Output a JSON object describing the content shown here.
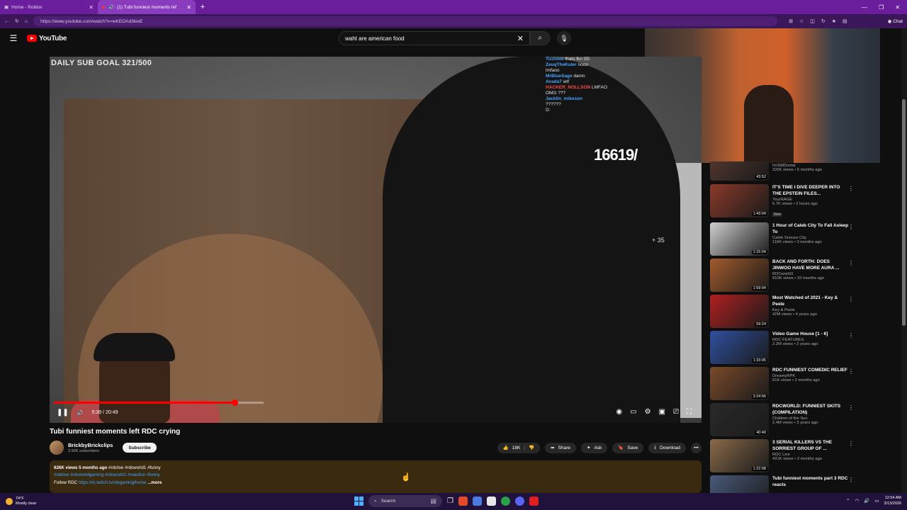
{
  "browser": {
    "tabs": [
      {
        "label": "Home - Roblox",
        "active": false
      },
      {
        "label": "(1) Tubi funniest moments lef",
        "active": true
      }
    ],
    "url": "https://www.youtube.com/watch?v=wKEOAd3kieE",
    "chat_label": "Chat"
  },
  "youtube": {
    "logo_text": "YouTube",
    "search_query": "waht are american food"
  },
  "video": {
    "overlay_goal": "DAILY SUB GOAL 321/500",
    "overlay_counter": "16619/",
    "overlay_plus": "+ 35",
    "time": "5:39 / 20:49",
    "progress_fraction": 0.27,
    "chat": [
      {
        "user": "Tizzious",
        "msg": "thats fkn 0D",
        "red": false
      },
      {
        "user": "ZeuqTheKuler",
        "msg": "nooo",
        "red": false
      },
      {
        "user": "",
        "msg": "lmfaoo",
        "red": false
      },
      {
        "user": "MrBlueSage",
        "msg": "damn",
        "red": false
      },
      {
        "user": "Avada7",
        "msg": "wtf",
        "red": false
      },
      {
        "user": "HACKER_NOLLSON",
        "msg": "LMFAO",
        "red": true
      },
      {
        "user": "",
        "msg": "OMG ???",
        "red": false
      },
      {
        "user": "Jacklin_mikeson",
        "msg": "",
        "red": false
      },
      {
        "user": "",
        "msg": "??????",
        "red": false
      },
      {
        "user": "",
        "msg": "D:",
        "red": true
      }
    ]
  },
  "meta": {
    "title": "Tubi funniest moments left RDC crying",
    "channel": "BrickbyBrickclips",
    "subscribers": "3.92K subscribers",
    "subscribe_label": "Subscribe",
    "likes": "18K",
    "share_label": "Share",
    "ask_label": "Ask",
    "save_label": "Save",
    "download_label": "Download",
    "desc_stats": "626K views  5 months ago",
    "desc_tags1": "#rdclive #rdcworld1 #funny",
    "desc_tags2": "#rdclive #rdcworldgaming #rdcworld1 #reaction #funny",
    "desc_follow": "Follow RDC",
    "desc_link": "https://m.twitch.tv/rdcgaming/home",
    "desc_more": "...more"
  },
  "sidebar": [
    {
      "title": "",
      "channel": "ImStillDontai",
      "views": "335K views • 5 months ago",
      "duration": "43:52",
      "new": false,
      "color": "#5a3a30"
    },
    {
      "title": "IT'S TIME I DIVE DEEPER INTO THE EPSTEIN FILES...",
      "channel": "YourRAGE",
      "views": "6.7K views • 2 hours ago",
      "duration": "1:43:04",
      "new": true,
      "new_label": "New",
      "color": "#8b3a2a"
    },
    {
      "title": "1 Hour of Caleb City To Fall Asleep To",
      "channel": "Caleb Snooze City",
      "views": "116K views • 3 months ago",
      "duration": "1:15:04",
      "new": false,
      "color": "#cfcfcf"
    },
    {
      "title": "BACK AND FORTH: DOES JINWOO HAVE MORE AURA ...",
      "channel": "RDCworld1",
      "views": "910K views • 10 months ago",
      "duration": "1:59:04",
      "new": false,
      "color": "#a35b2c"
    },
    {
      "title": "Most Watched of 2021 - Key & Peele",
      "channel": "Key & Peele",
      "views": "42M views • 4 years ago",
      "duration": "59:24",
      "new": false,
      "color": "#b02020"
    },
    {
      "title": "Video Game House [1 - 6]",
      "channel": "RDC FEATURES",
      "views": "2.2M views • 2 years ago",
      "duration": "1:33:05",
      "new": false,
      "color": "#3050a0"
    },
    {
      "title": "RDC FUNNIEST COMEDIC RELIEF",
      "channel": "DreamyRPK",
      "views": "61K views • 2 months ago",
      "duration": "3:24:56",
      "new": false,
      "color": "#7a4a2a"
    },
    {
      "title": "RDCWORLD: FUNNIEST SKITS (COMPILATION)",
      "channel": "Children of the Sun",
      "views": "2.4M views • 3 years ago",
      "duration": "40:40",
      "new": false,
      "color": "#2a2a2a"
    },
    {
      "title": "3 SERIAL KILLERS VS THE SORRIEST GROUP OF ...",
      "channel": "RDC Live",
      "views": "431K views • 2 months ago",
      "duration": "1:22:08",
      "new": false,
      "color": "#8a6a4a"
    },
    {
      "title": "Tubi funniest moments part 3 RDC reacts",
      "channel": "",
      "views": "",
      "duration": "",
      "new": false,
      "color": "#4a5a7a"
    }
  ],
  "taskbar": {
    "temp": "74°F",
    "weather": "Mostly clear",
    "search_label": "Search",
    "time": "12:54 AM",
    "date": "3/13/2026"
  }
}
